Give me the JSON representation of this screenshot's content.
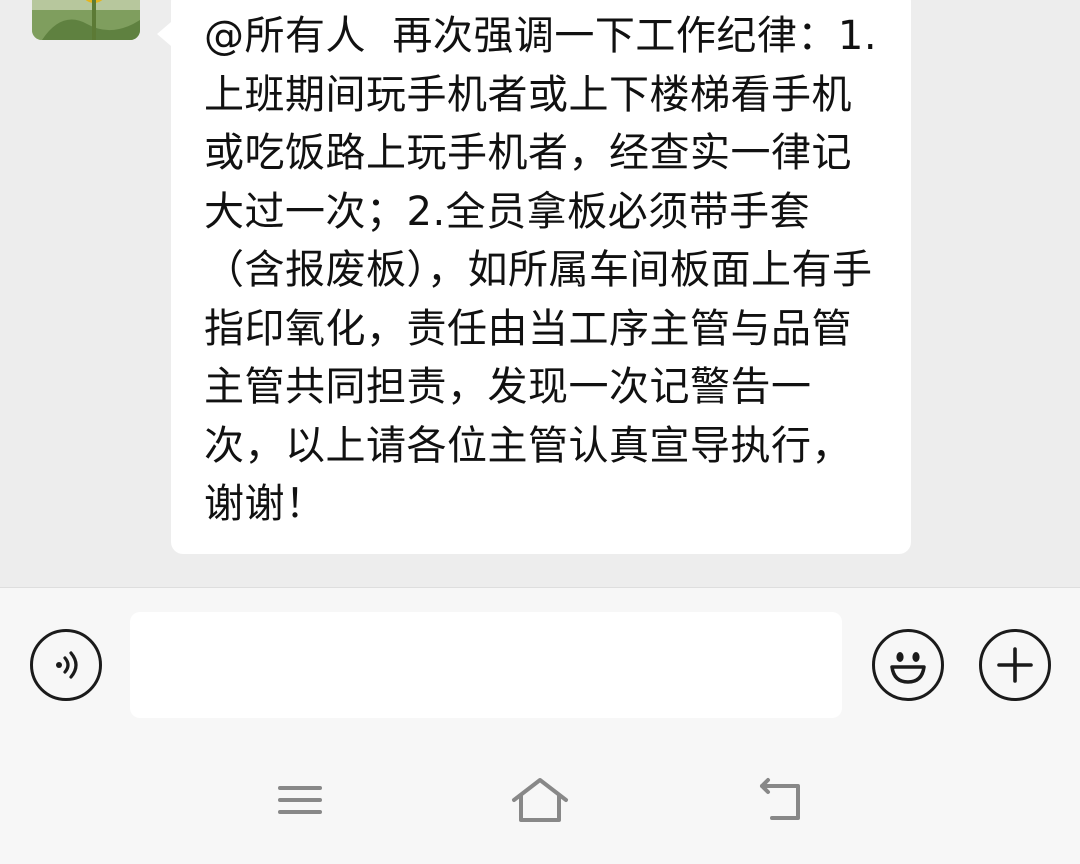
{
  "message": {
    "text": "@所有人  再次强调一下工作纪律：1.上班期间玩手机者或上下楼梯看手机或吃饭路上玩手机者，经查实一律记大过一次；2.全员拿板必须带手套（含报废板），如所属车间板面上有手指印氧化，责任由当工序主管与品管主管共同担责，发现一次记警告一次，以上请各位主管认真宣导执行，谢谢！"
  },
  "input_bar": {
    "voice_icon": "voice-icon",
    "emoji_icon": "emoji-icon",
    "plus_icon": "plus-icon",
    "input_value": ""
  },
  "nav_bar": {
    "menu_icon": "menu-icon",
    "home_icon": "home-icon",
    "back_icon": "back-icon"
  },
  "colors": {
    "chat_background": "#ededed",
    "bubble": "#ffffff",
    "bar_background": "#f7f7f7",
    "icon": "#1b1b1b"
  }
}
